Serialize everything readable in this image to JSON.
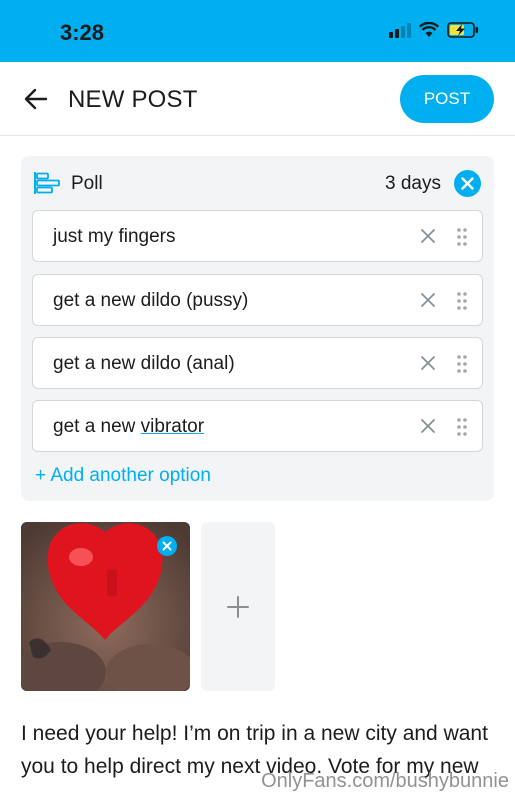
{
  "status_bar": {
    "time": "3:28"
  },
  "header": {
    "title": "NEW POST",
    "post_label": "POST"
  },
  "poll": {
    "label": "Poll",
    "duration": "3 days",
    "options": [
      {
        "text": "just my fingers"
      },
      {
        "text": "get a new dildo (pussy)"
      },
      {
        "text": "get a new dildo (anal)"
      },
      {
        "text_before": "get a new ",
        "text_underlined": "vibrator"
      }
    ],
    "add_option": "+ Add another option"
  },
  "caption": "I need your help! I’m on trip in a new city and want you to help direct my next video. Vote for my new",
  "watermark": "OnlyFans.com/bushybunnie",
  "colors": {
    "accent": "#00aff0",
    "card_bg": "#f2f4f5",
    "heart": "#e0141e"
  }
}
